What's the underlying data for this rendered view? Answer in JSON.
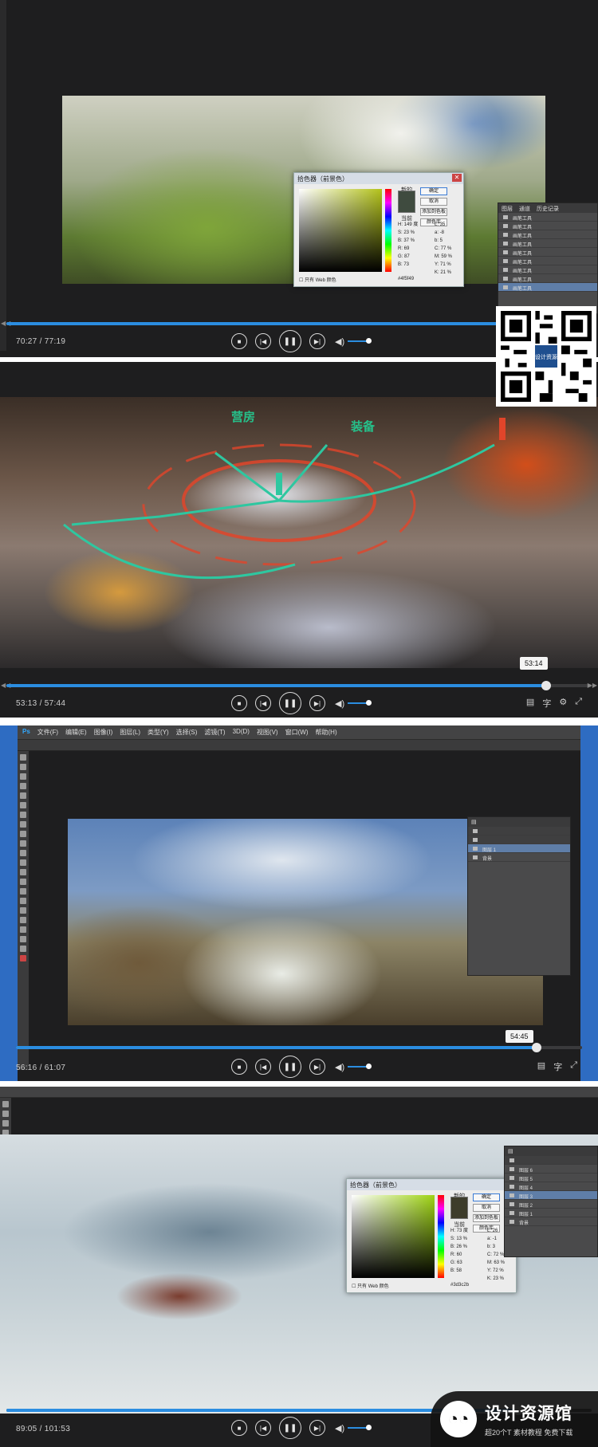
{
  "panels": [
    {
      "time": "70:27 / 77:19",
      "progress": 0.911,
      "picker": {
        "title": "拾色器（前景色）",
        "new_label": "新的",
        "current_label": "当前",
        "ok": "确定",
        "cancel": "取消",
        "add_swatch": "添加到色板",
        "libraries": "颜色库",
        "hex_label": "#",
        "hex": "4f5f49",
        "web_only": "只有 Web 颜色",
        "values": [
          "H: 149 度",
          "S: 23 %",
          "B: 37 %",
          "R: 69",
          "G: 87",
          "B: 73",
          "L: 35",
          "a: -8",
          "b: 5",
          "C: 77 %",
          "M: 59 %",
          "Y: 71 %",
          "K: 21 %"
        ]
      },
      "layer_tabs": [
        "图层",
        "通道",
        "历史记录"
      ],
      "layers": [
        "画笔工具",
        "画笔工具",
        "画笔工具",
        "画笔工具",
        "画笔工具",
        "画笔工具",
        "画笔工具",
        "画笔工具",
        "画笔工具"
      ]
    },
    {
      "time": "53:13 / 57:44",
      "progress": 0.922,
      "tooltip": "53:14",
      "sketch_labels": [
        "营房",
        "装备"
      ]
    },
    {
      "time": "56:16 / 61:07",
      "progress": 0.92,
      "tooltip": "54:45",
      "menu": [
        "Ps",
        "文件(F)",
        "编辑(E)",
        "图像(I)",
        "图层(L)",
        "类型(Y)",
        "选择(S)",
        "滤镜(T)",
        "3D(D)",
        "视图(V)",
        "窗口(W)",
        "帮助(H)"
      ],
      "layers": [
        "图层 1",
        "背景"
      ]
    },
    {
      "time": "89:05 / 101:53",
      "progress": 0.874,
      "picker": {
        "title": "拾色器（前景色）",
        "new_label": "新的",
        "current_label": "当前",
        "ok": "确定",
        "cancel": "取消",
        "add_swatch": "添加到色板",
        "libraries": "颜色库",
        "hex_label": "#",
        "hex": "3d3c2b",
        "web_only": "只有 Web 颜色",
        "values": [
          "H: 73 度",
          "S: 13 %",
          "B: 26 %",
          "R: 60",
          "G: 63",
          "B: 58",
          "L: 26",
          "a: -1",
          "b: 3",
          "C: 72 %",
          "M: 63 %",
          "Y: 72 %",
          "K: 23 %"
        ]
      },
      "layers": [
        "图层 6",
        "图层 5",
        "图层 4",
        "图层 3",
        "图层 2",
        "图层 1",
        "背景"
      ]
    }
  ],
  "qr_center_label": "设计资源",
  "watermark": {
    "title": "设计资源馆",
    "subtitle": "超20个T 素材教程 免费下载",
    "icon": "wechat-icon"
  },
  "colors": {
    "accent": "#2b8de0",
    "sketch": "#26c08a",
    "panel_bg": "#1e1e1f"
  }
}
